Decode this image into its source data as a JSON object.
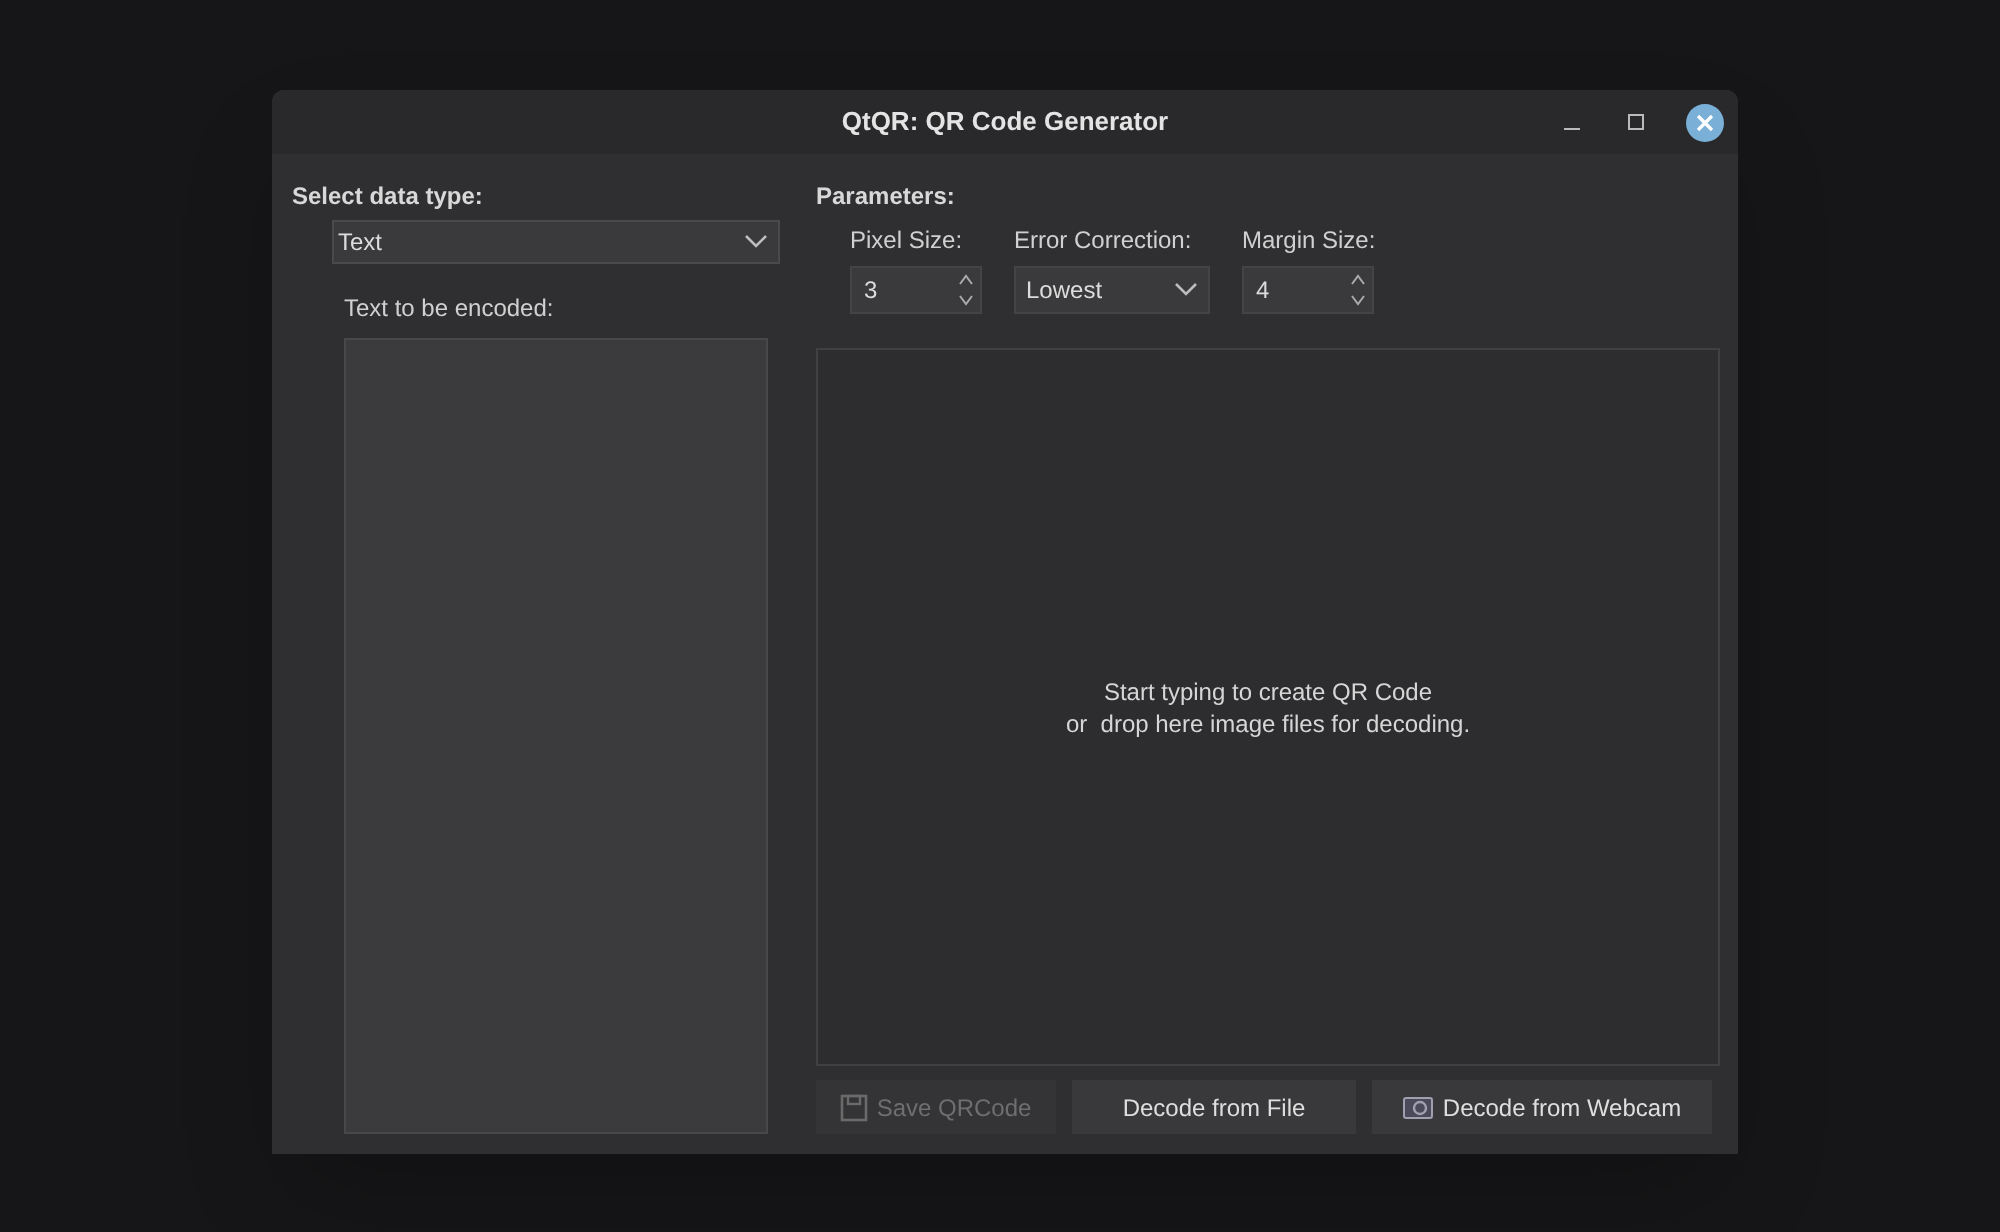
{
  "window": {
    "title": "QtQR: QR Code Generator"
  },
  "data_type": {
    "heading": "Select data type:",
    "value": "Text",
    "text_label": "Text to be encoded:"
  },
  "parameters": {
    "heading": "Parameters:",
    "fields": [
      {
        "kind": "spin",
        "label": "Pixel Size:",
        "value": "3"
      },
      {
        "kind": "select",
        "label": "Error Correction:",
        "value": "Lowest"
      },
      {
        "kind": "spin",
        "label": "Margin Size:",
        "value": "4"
      }
    ]
  },
  "preview": {
    "lines": [
      "Start typing to create QR Code",
      "or  drop here image files for decoding."
    ]
  },
  "buttons": [
    {
      "kind": "save",
      "label": "Save QRCode",
      "disabled": true
    },
    {
      "kind": "file",
      "label": "Decode from File",
      "disabled": false
    },
    {
      "kind": "webcam",
      "label": "Decode from Webcam",
      "disabled": false
    }
  ]
}
